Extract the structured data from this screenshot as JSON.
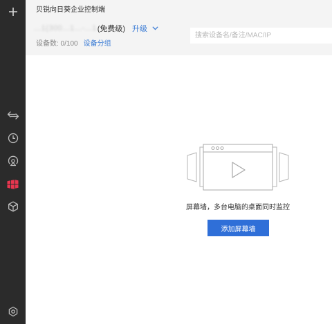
{
  "app": {
    "title": "贝锐向日葵企业控制端"
  },
  "account": {
    "name": "...1(300...1...-...1",
    "level": "(免费级)",
    "upgrade_label": "升级"
  },
  "devices": {
    "count_label": "设备数: 0/100",
    "group_label": "设备分组"
  },
  "search": {
    "placeholder": "搜索设备名/备注/MAC/IP",
    "value": ""
  },
  "empty_state": {
    "message": "屏幕墙，多台电脑的桌面同时监控",
    "button_label": "添加屏幕墙"
  },
  "sidebar": {
    "items": [
      {
        "icon": "plus-icon",
        "active": false
      },
      {
        "icon": "remote-control-icon",
        "active": false
      },
      {
        "icon": "clock-icon",
        "active": false
      },
      {
        "icon": "remote-monitor-icon",
        "active": false
      },
      {
        "icon": "screen-wall-icon",
        "active": true
      },
      {
        "icon": "cube-icon",
        "active": false
      },
      {
        "icon": "settings-icon",
        "active": false
      }
    ]
  },
  "colors": {
    "sidebar_bg": "#2b2b2b",
    "header_bg": "#f4f4f4",
    "accent": "#2f6fd8",
    "link": "#3a7bd5",
    "active_icon": "#e8364f",
    "icon_gray": "#bdbdbd"
  }
}
